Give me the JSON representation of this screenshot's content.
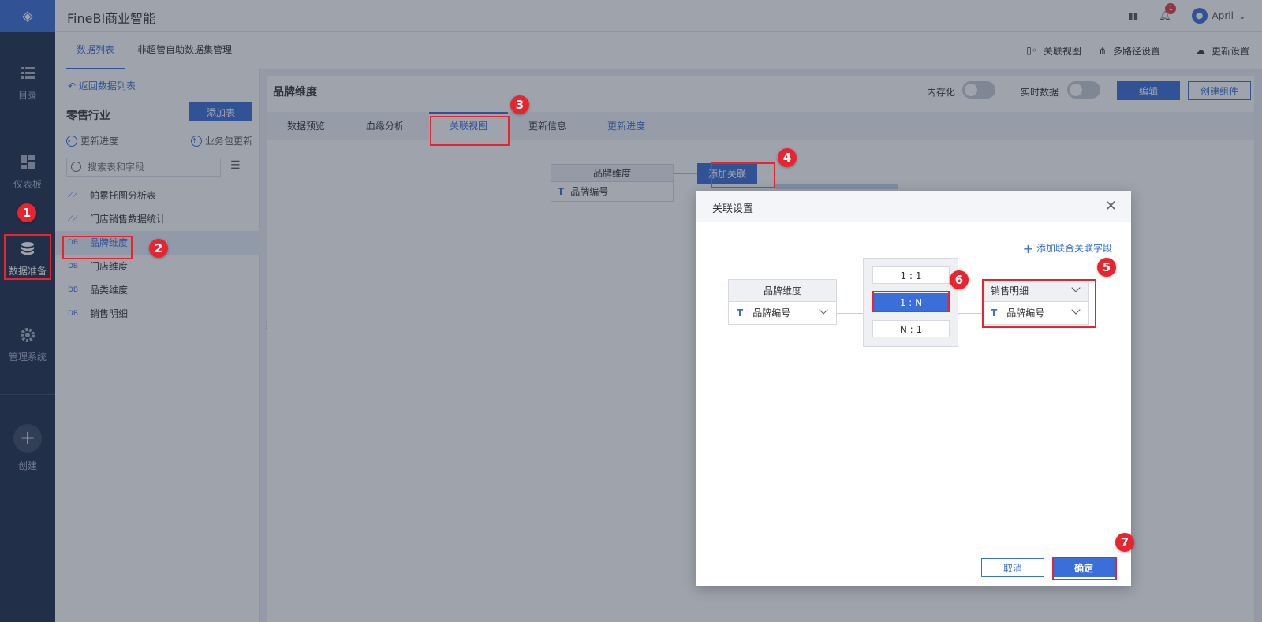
{
  "app": {
    "title": "FineBI商业智能",
    "notification_count": "1",
    "user_name": "April"
  },
  "nav": {
    "items": [
      {
        "label": "目录",
        "icon": "list-icon"
      },
      {
        "label": "仪表板",
        "icon": "dashboard-icon"
      },
      {
        "label": "数据准备",
        "icon": "database-icon"
      },
      {
        "label": "管理系统",
        "icon": "gear-icon"
      },
      {
        "label": "创建",
        "icon": "plus-icon"
      }
    ]
  },
  "subtabs": {
    "items": [
      "数据列表",
      "非超管自助数据集管理"
    ],
    "right_actions": [
      "关联视图",
      "多路径设置",
      "更新设置"
    ]
  },
  "side": {
    "back_label": "返回数据列表",
    "package_title": "零售行业",
    "add_table_label": "添加表",
    "update_progress_label": "更新进度",
    "package_update_label": "业务包更新",
    "search_placeholder": "搜索表和字段",
    "tables": [
      {
        "name": "帕累托图分析表",
        "type": "self"
      },
      {
        "name": "门店销售数据统计",
        "type": "self"
      },
      {
        "name": "品牌维度",
        "type": "db"
      },
      {
        "name": "门店维度",
        "type": "db"
      },
      {
        "name": "品类维度",
        "type": "db"
      },
      {
        "name": "销售明细",
        "type": "db"
      }
    ],
    "db_tag": "DB"
  },
  "main": {
    "title": "品牌维度",
    "switch_memory_label": "内存化",
    "switch_realtime_label": "实时数据",
    "edit_label": "编辑",
    "create_component_label": "创建组件",
    "tabs": [
      "数据预览",
      "血缘分析",
      "关联视图",
      "更新信息",
      "更新进度"
    ],
    "node": {
      "header": "品牌维度",
      "field": "品牌编号"
    },
    "add_relation_label": "添加关联"
  },
  "dialog": {
    "title": "关联设置",
    "add_union_label": "添加联合关联字段",
    "left_table": {
      "header": "品牌维度",
      "field": "品牌编号"
    },
    "relations": [
      "1 : 1",
      "1 : N",
      "N : 1"
    ],
    "selected_relation": "1 : N",
    "right_table": {
      "header": "销售明细",
      "field": "品牌编号"
    },
    "cancel_label": "取消",
    "ok_label": "确定"
  },
  "annotations": [
    "1",
    "2",
    "3",
    "4",
    "5",
    "6",
    "7"
  ],
  "colors": {
    "accent": "#3a6ed8",
    "nav_bg": "#1e2c4a",
    "highlight": "#e8242f"
  }
}
